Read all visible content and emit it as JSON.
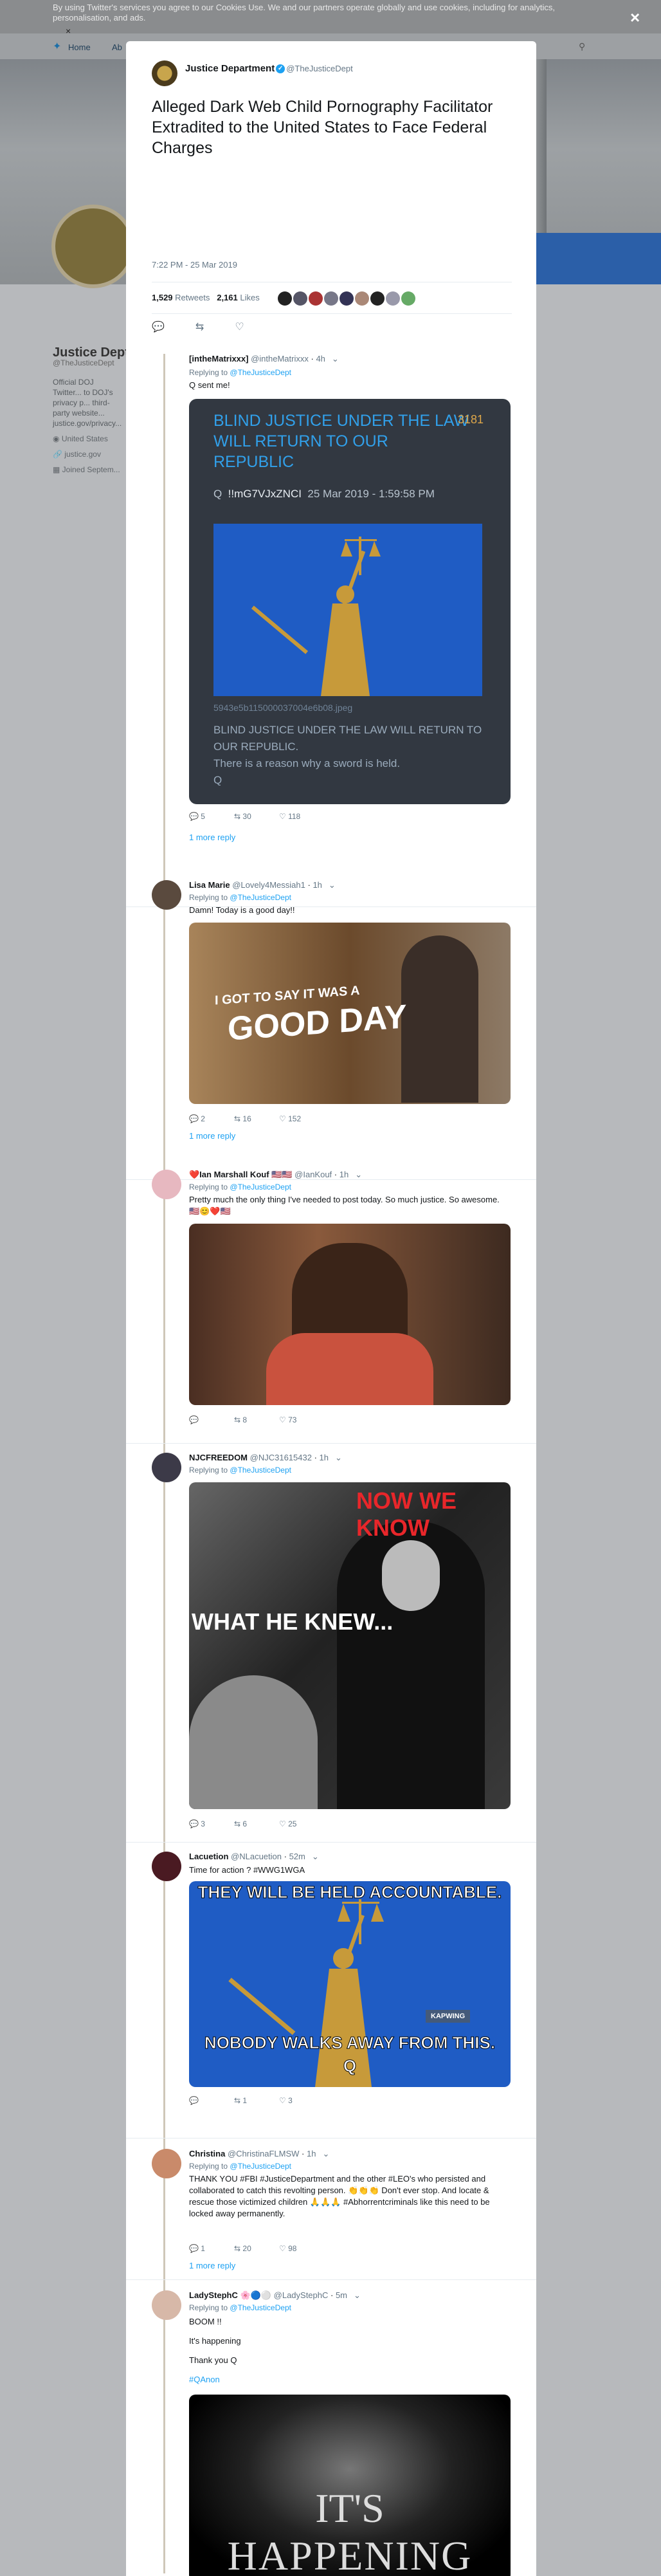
{
  "cookie": {
    "text": "By using Twitter's services you agree to our Cookies Use. We and our partners operate globally and use cookies, including for analytics, personalisation, and ads.",
    "close": "×"
  },
  "modal_close": "×",
  "nav": {
    "home": "Home",
    "about": "Ab"
  },
  "profile": {
    "name": "Justice Dept",
    "handle": "@TheJusticeDept",
    "bio": "Official DOJ Twitter... to DOJ's privacy p... third-party website... justice.gov/privacy...",
    "location": "United States",
    "url": "justice.gov",
    "joined": "Joined Septem..."
  },
  "tweet": {
    "name": "Justice Department",
    "handle": "@TheJusticeDept",
    "text": "Alleged Dark Web Child Pornography Facilitator Extradited to the United States to Face Federal Charges",
    "time": "7:22 PM - 25 Mar 2019",
    "retweets": "1,529",
    "retweets_label": "Retweets",
    "likes": "2,161",
    "likes_label": "Likes"
  },
  "replying_label": "Replying to",
  "replying_handle": "@TheJusticeDept",
  "replies": [
    {
      "name": "[intheMatrixxx]",
      "handle": "@intheMatrixxx",
      "time": "4h",
      "text": "Q sent me!",
      "reply": "5",
      "rt": "30",
      "like": "118",
      "more": "1 more reply"
    },
    {
      "name": "Lisa Marie",
      "handle": "@Lovely4Messiah1",
      "time": "1h",
      "text": "Damn! Today is a good day!!",
      "reply": "2",
      "rt": "16",
      "like": "152",
      "more": "1 more reply",
      "caption1": "I GOT TO SAY IT WAS A",
      "caption2": "GOOD DAY"
    },
    {
      "name": "❤️Ian Marshall Kouf 🇺🇸🇺🇸",
      "handle": "@IanKouf",
      "time": "1h",
      "text": "Pretty much the only thing I've needed to post today. So much justice. So awesome. 🇺🇸😊❤️🇺🇸",
      "reply": "",
      "rt": "8",
      "like": "73"
    },
    {
      "name": "NJCFREEDOM",
      "handle": "@NJC31615432",
      "time": "1h",
      "reply": "3",
      "rt": "6",
      "like": "25",
      "caption1": "NOW WE KNOW",
      "caption2": "WHAT HE KNEW..."
    },
    {
      "name": "Lacuetion",
      "handle": "@NLacuetion",
      "time": "52m",
      "text": "Time for action ?  #WWG1WGA",
      "reply": "",
      "rt": "1",
      "like": "3",
      "caption1": "THEY WILL BE HELD ACCOUNTABLE.",
      "caption2": "NOBODY WALKS AWAY FROM THIS.",
      "caption3": "Q",
      "wm": "KAPWING"
    },
    {
      "name": "Christina",
      "handle": "@ChristinaFLMSW",
      "time": "1h",
      "text": "THANK YOU #FBI #JusticeDepartment and the other #LEO's who persisted and collaborated to catch this revolting person. 👏👏👏 Don't ever stop. And locate & rescue those victimized children 🙏🙏🙏 #Abhorrentcriminals like this need to be locked away permanently.",
      "reply": "1",
      "rt": "20",
      "like": "98",
      "more": "1 more reply"
    },
    {
      "name": "LadyStephC 🌸🔵⚪",
      "handle": "@LadyStephC",
      "time": "5m",
      "text1": "BOOM !!",
      "text2": "It's happening",
      "text3": "Thank you Q",
      "text4": "#QAnon",
      "caption1": "IT'S",
      "caption2": "HAPPENING"
    }
  ],
  "qcard": {
    "title": "BLIND JUSTICE UNDER THE LAW WILL RETURN TO OUR REPUBLIC",
    "num": "3181",
    "trip": "!!mG7VJxZNCI",
    "date": "25 Mar 2019 - 1:59:58 PM",
    "file": "5943e5b115000037004e6b08.jpeg",
    "body1": "BLIND JUSTICE UNDER THE LAW WILL RETURN TO OUR REPUBLIC.",
    "body2": "There is a reason why a sword is held.",
    "body3": "Q"
  }
}
